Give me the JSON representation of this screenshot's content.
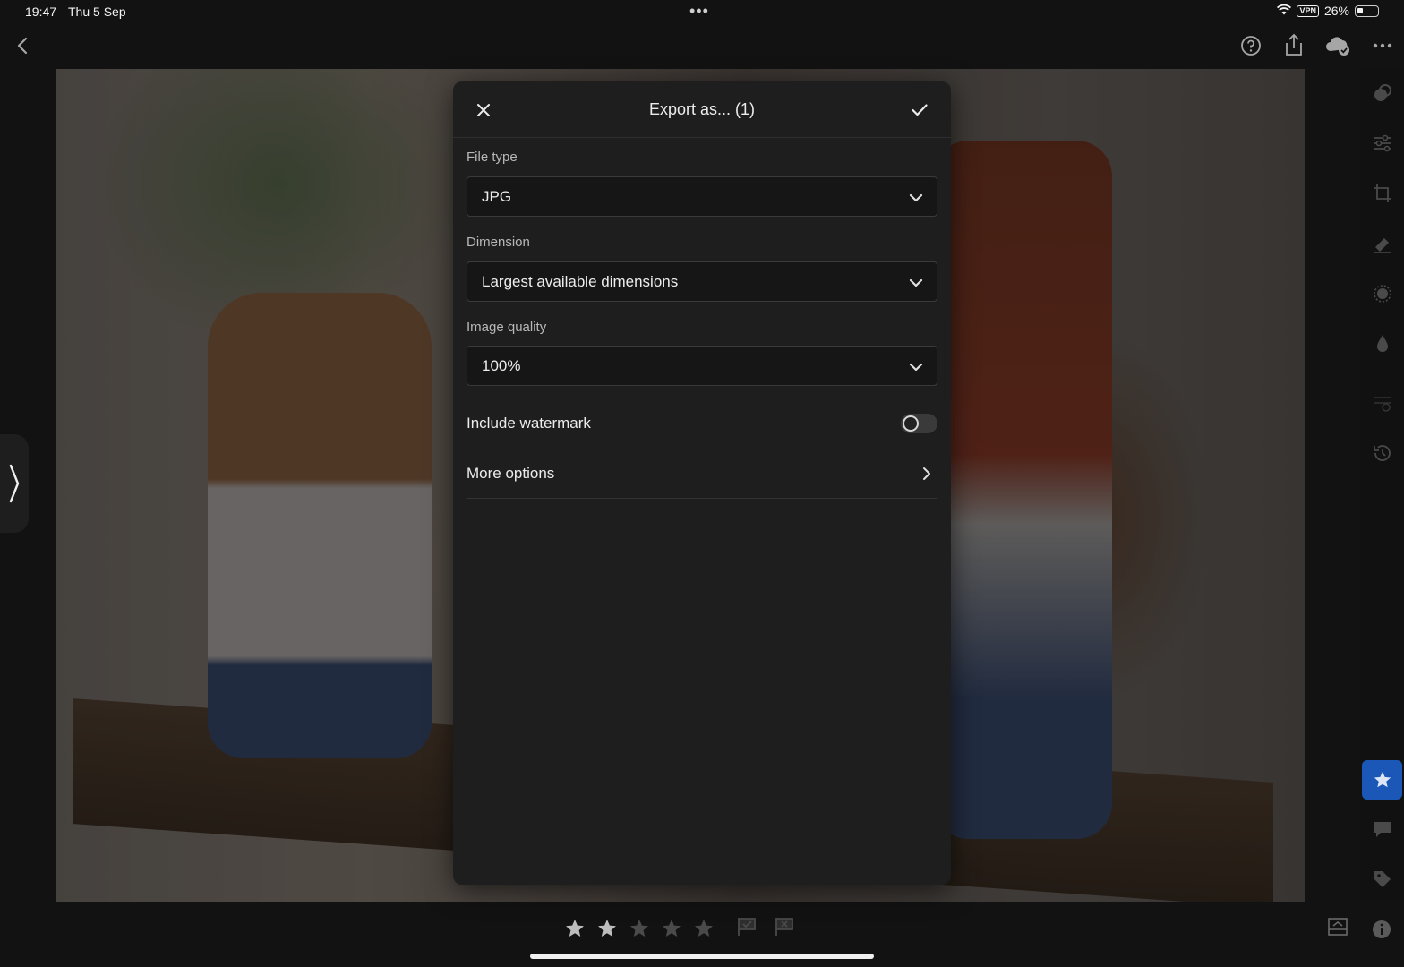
{
  "status_bar": {
    "time": "19:47",
    "date": "Thu 5 Sep",
    "vpn": "VPN",
    "battery": "26%",
    "multitask_dots": "•••"
  },
  "toolbar": {
    "icons": [
      "back-icon",
      "help-icon",
      "share-icon",
      "cloud-sync-icon",
      "more-icon"
    ]
  },
  "right_panel": {
    "icons": [
      "presets-icon",
      "edit-sliders-icon",
      "crop-icon",
      "healing-icon",
      "masking-icon",
      "blur-icon",
      "versions-icon",
      "history-icon",
      "rating-icon",
      "comments-icon",
      "keywords-icon",
      "info-icon"
    ],
    "active": "rating-icon",
    "active_color": "#1b57b6"
  },
  "bottom_bar": {
    "rating": 2,
    "max_rating": 5,
    "flags": [
      "pick-flag-icon",
      "reject-flag-icon"
    ],
    "filmstrip_icon": "filmstrip-icon"
  },
  "dialog": {
    "title": "Export as... (1)",
    "file_type": {
      "label": "File type",
      "value": "JPG"
    },
    "dimension": {
      "label": "Dimension",
      "value": "Largest available dimensions"
    },
    "image_quality": {
      "label": "Image quality",
      "value": "100%"
    },
    "watermark": {
      "label": "Include watermark",
      "enabled": false
    },
    "more_options": {
      "label": "More options"
    }
  }
}
